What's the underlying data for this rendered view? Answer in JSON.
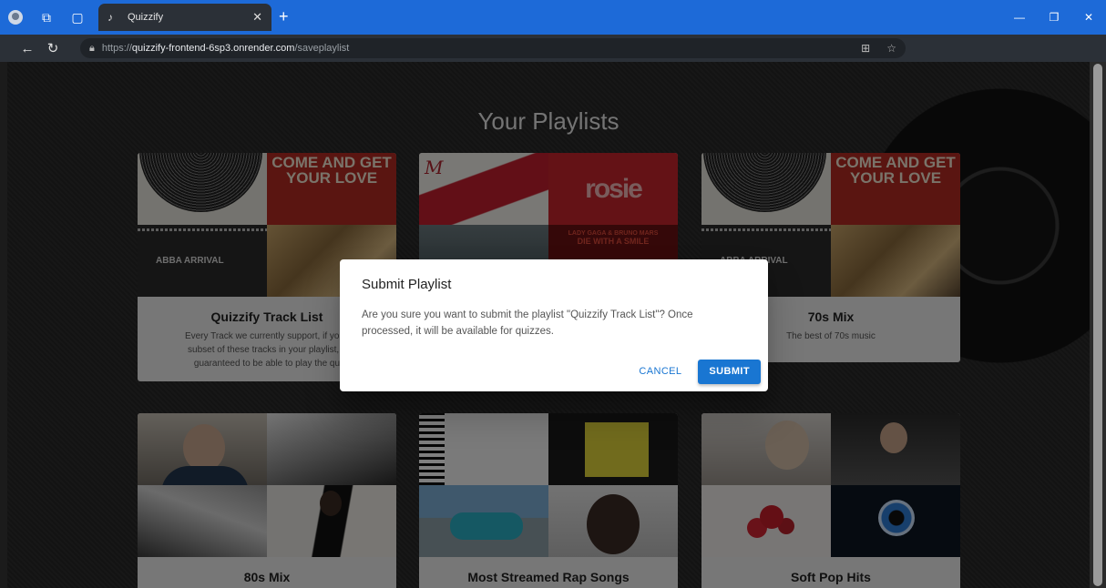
{
  "browser": {
    "tab_title": "Quizzify",
    "url_proto": "https://",
    "url_host": "quizzify-frontend-6sp3.onrender.com",
    "url_path": "/saveplaylist"
  },
  "page": {
    "title": "Your Playlists"
  },
  "covers": {
    "abba_label": "ABBA ARRIVAL",
    "come_get_line1": "COME AND GET",
    "come_get_line2": "YOUR LOVE",
    "rosie_label": "rosie",
    "lgbm_line1": "LADY GAGA & BRUNO MARS",
    "lgbm_line2": "DIE WITH A SMILE",
    "xmas_script": "M"
  },
  "playlists": [
    {
      "title": "Quizzify Track List",
      "description_line1": "Every Track we currently support, if you i",
      "description_line2": "subset of these tracks in your playlist, y",
      "description_line3": "guaranteed to be able to play the qu"
    },
    {
      "title": "",
      "description_line1": ""
    },
    {
      "title": "70s Mix",
      "description_line1": "The best of 70s music"
    },
    {
      "title": "80s Mix"
    },
    {
      "title": "Most Streamed Rap Songs"
    },
    {
      "title": "Soft Pop Hits"
    }
  ],
  "dialog": {
    "title": "Submit Playlist",
    "message": "Are you sure you want to submit the playlist \"Quizzify Track List\"? Once processed, it will be available for quizzes.",
    "cancel_label": "CANCEL",
    "submit_label": "SUBMIT"
  },
  "colors": {
    "chrome_blue": "#1d6ad8",
    "primary": "#1976d2"
  }
}
